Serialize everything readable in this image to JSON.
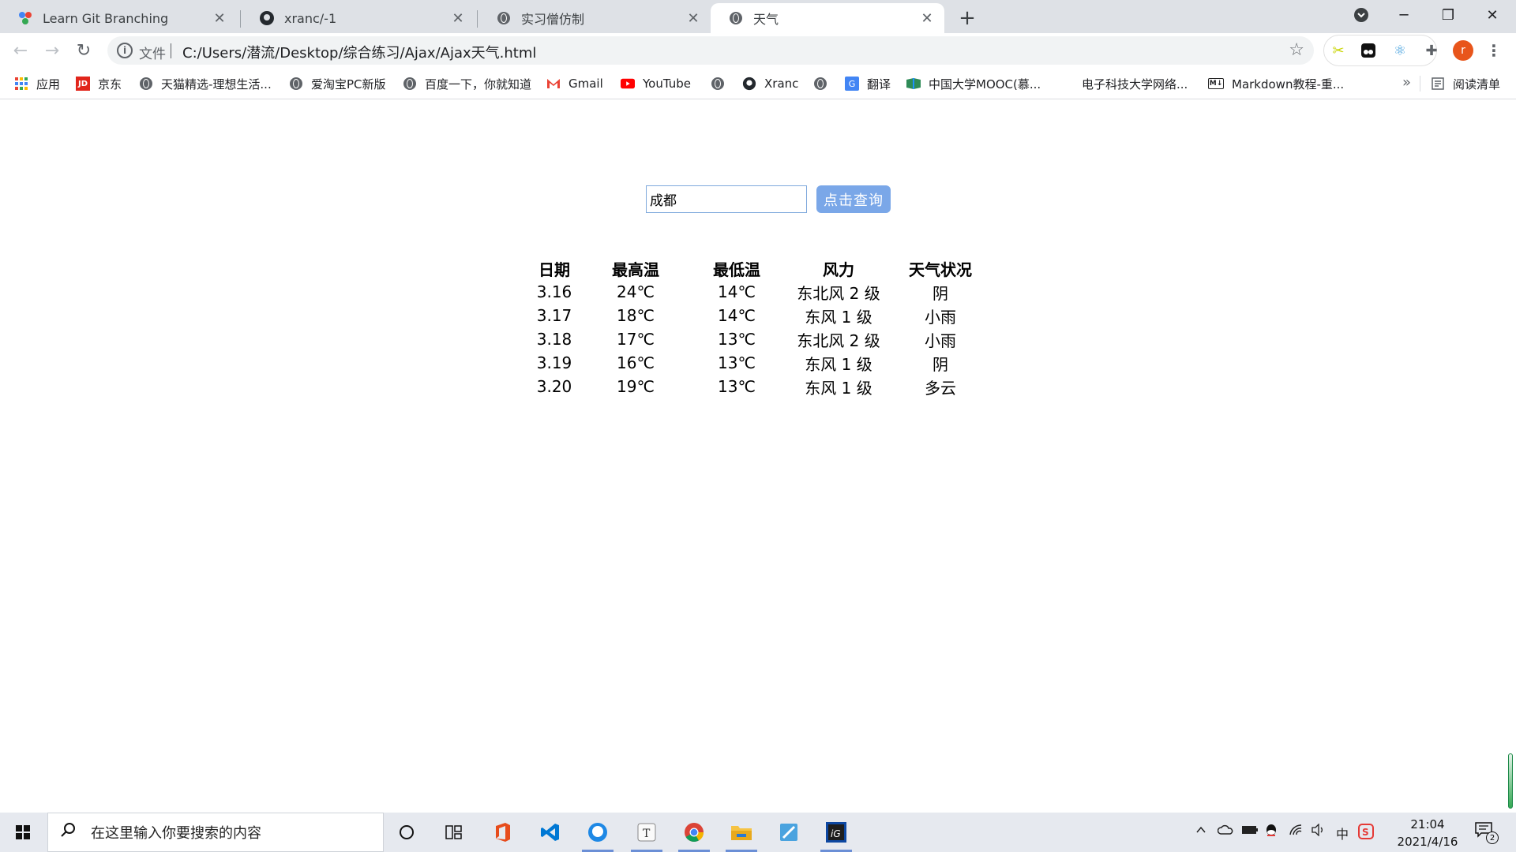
{
  "browser": {
    "tabs": [
      {
        "title": "Learn Git Branching",
        "icon": "git-branching-icon"
      },
      {
        "title": "xranc/-1",
        "icon": "github-icon"
      },
      {
        "title": "实习僧仿制",
        "icon": "globe-icon"
      },
      {
        "title": "天气",
        "icon": "globe-icon",
        "active": true
      }
    ],
    "address": {
      "scheme_label": "文件",
      "url": "C:/Users/潜流/Desktop/综合练习/Ajax/Ajax天气.html"
    },
    "profile_initial": "r",
    "bookmarks": [
      {
        "label": "应用",
        "icon": "apps-grid-icon"
      },
      {
        "label": "京东",
        "icon": "jd-icon"
      },
      {
        "label": "天猫精选-理想生活...",
        "icon": "globe-icon"
      },
      {
        "label": "爱淘宝PC新版",
        "icon": "globe-icon"
      },
      {
        "label": "百度一下，你就知道",
        "icon": "globe-icon"
      },
      {
        "label": "Gmail",
        "icon": "gmail-icon"
      },
      {
        "label": "YouTube",
        "icon": "youtube-icon"
      },
      {
        "label": "",
        "icon": "globe-icon"
      },
      {
        "label": "Xranc",
        "icon": "github-icon"
      },
      {
        "label": "",
        "icon": "globe-icon"
      },
      {
        "label": "翻译",
        "icon": "translate-icon"
      },
      {
        "label": "中国大学MOOC(慕...",
        "icon": "mooc-icon"
      },
      {
        "label": "电子科技大学网络...",
        "icon": "none"
      },
      {
        "label": "Markdown教程-重...",
        "icon": "markdown-icon"
      }
    ],
    "more_bookmarks": "»",
    "reading_list": "阅读清单"
  },
  "page": {
    "city_input_value": "成都",
    "query_button": "点击查询",
    "table": {
      "headers": [
        "日期",
        "最高温",
        "最低温",
        "风力",
        "天气状况"
      ],
      "rows": [
        [
          "3.16",
          "24℃",
          "14℃",
          "东北风 2 级",
          "阴"
        ],
        [
          "3.17",
          "18℃",
          "14℃",
          "东风 1 级",
          "小雨"
        ],
        [
          "3.18",
          "17℃",
          "13℃",
          "东北风 2 级",
          "小雨"
        ],
        [
          "3.19",
          "16℃",
          "13℃",
          "东风 1 级",
          "阴"
        ],
        [
          "3.20",
          "19℃",
          "13℃",
          "东风 1 级",
          "多云"
        ]
      ]
    }
  },
  "taskbar": {
    "search_placeholder": "在这里输入你要搜索的内容",
    "time": "21:04",
    "date": "2021/4/16",
    "ime": "中",
    "notification_count": "2"
  }
}
